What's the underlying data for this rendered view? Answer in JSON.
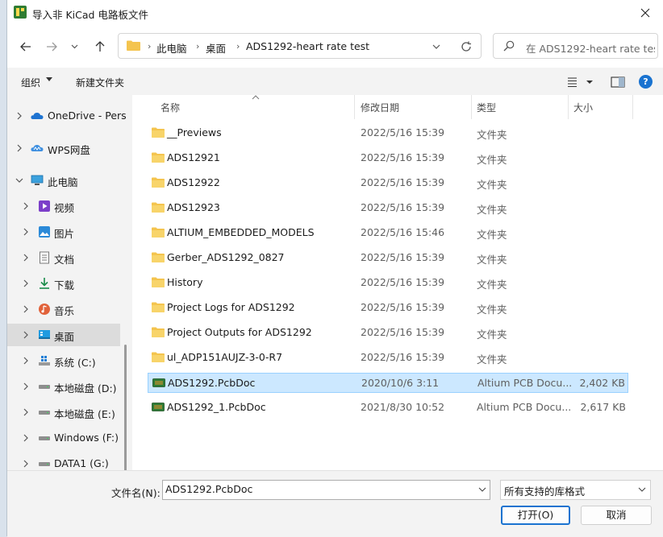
{
  "window": {
    "title": "导入非 KiCad 电路板文件"
  },
  "address": {
    "crumbs": [
      "此电脑",
      "桌面",
      "ADS1292-heart rate test"
    ],
    "separator": "›"
  },
  "search": {
    "placeholder": "在 ADS1292-heart rate tes..."
  },
  "toolbar": {
    "organize_label": "组织",
    "new_folder_label": "新建文件夹"
  },
  "sidebar": {
    "items": [
      {
        "label": "OneDrive - Pers",
        "icon": "cloud-icon"
      },
      {
        "label": "WPS网盘",
        "icon": "wps-cloud-icon"
      },
      {
        "label": "此电脑",
        "icon": "computer-icon"
      },
      {
        "label": "视频",
        "icon": "video-icon"
      },
      {
        "label": "图片",
        "icon": "picture-icon"
      },
      {
        "label": "文档",
        "icon": "document-icon"
      },
      {
        "label": "下载",
        "icon": "download-icon"
      },
      {
        "label": "音乐",
        "icon": "music-icon"
      },
      {
        "label": "桌面",
        "icon": "desktop-icon",
        "selected": true
      },
      {
        "label": "系统 (C:)",
        "icon": "windows-drive-icon"
      },
      {
        "label": "本地磁盘 (D:)",
        "icon": "drive-icon"
      },
      {
        "label": "本地磁盘 (E:)",
        "icon": "drive-icon"
      },
      {
        "label": "Windows (F:)",
        "icon": "drive-icon"
      },
      {
        "label": "DATA1 (G:)",
        "icon": "drive-icon"
      }
    ]
  },
  "columns": {
    "name": "名称",
    "date": "修改日期",
    "type": "类型",
    "size": "大小"
  },
  "files": [
    {
      "name": "__Previews",
      "date": "2022/5/16 15:39",
      "type": "文件夹",
      "size": "",
      "kind": "folder"
    },
    {
      "name": "ADS12921",
      "date": "2022/5/16 15:39",
      "type": "文件夹",
      "size": "",
      "kind": "folder"
    },
    {
      "name": "ADS12922",
      "date": "2022/5/16 15:39",
      "type": "文件夹",
      "size": "",
      "kind": "folder"
    },
    {
      "name": "ADS12923",
      "date": "2022/5/16 15:39",
      "type": "文件夹",
      "size": "",
      "kind": "folder"
    },
    {
      "name": "ALTIUM_EMBEDDED_MODELS",
      "date": "2022/5/16 15:46",
      "type": "文件夹",
      "size": "",
      "kind": "folder"
    },
    {
      "name": "Gerber_ADS1292_0827",
      "date": "2022/5/16 15:39",
      "type": "文件夹",
      "size": "",
      "kind": "folder"
    },
    {
      "name": "History",
      "date": "2022/5/16 15:39",
      "type": "文件夹",
      "size": "",
      "kind": "folder"
    },
    {
      "name": "Project Logs for ADS1292",
      "date": "2022/5/16 15:39",
      "type": "文件夹",
      "size": "",
      "kind": "folder"
    },
    {
      "name": "Project Outputs for ADS1292",
      "date": "2022/5/16 15:39",
      "type": "文件夹",
      "size": "",
      "kind": "folder"
    },
    {
      "name": "ul_ADP151AUJZ-3-0-R7",
      "date": "2022/5/16 15:39",
      "type": "文件夹",
      "size": "",
      "kind": "folder"
    },
    {
      "name": "ADS1292.PcbDoc",
      "date": "2020/10/6 3:11",
      "type": "Altium PCB Docu...",
      "size": "2,402 KB",
      "kind": "pcb",
      "selected": true
    },
    {
      "name": "ADS1292_1.PcbDoc",
      "date": "2021/8/30 10:52",
      "type": "Altium PCB Docu...",
      "size": "2,617 KB",
      "kind": "pcb"
    }
  ],
  "bottom": {
    "filename_label": "文件名(N):",
    "filename_value": "ADS1292.PcbDoc",
    "filter_value": "所有支持的库格式",
    "open_label": "打开(O)",
    "cancel_label": "取消"
  },
  "colors": {
    "accent": "#1a73d0",
    "selection_bg": "#cce8ff",
    "folder": "#f4c44e"
  }
}
